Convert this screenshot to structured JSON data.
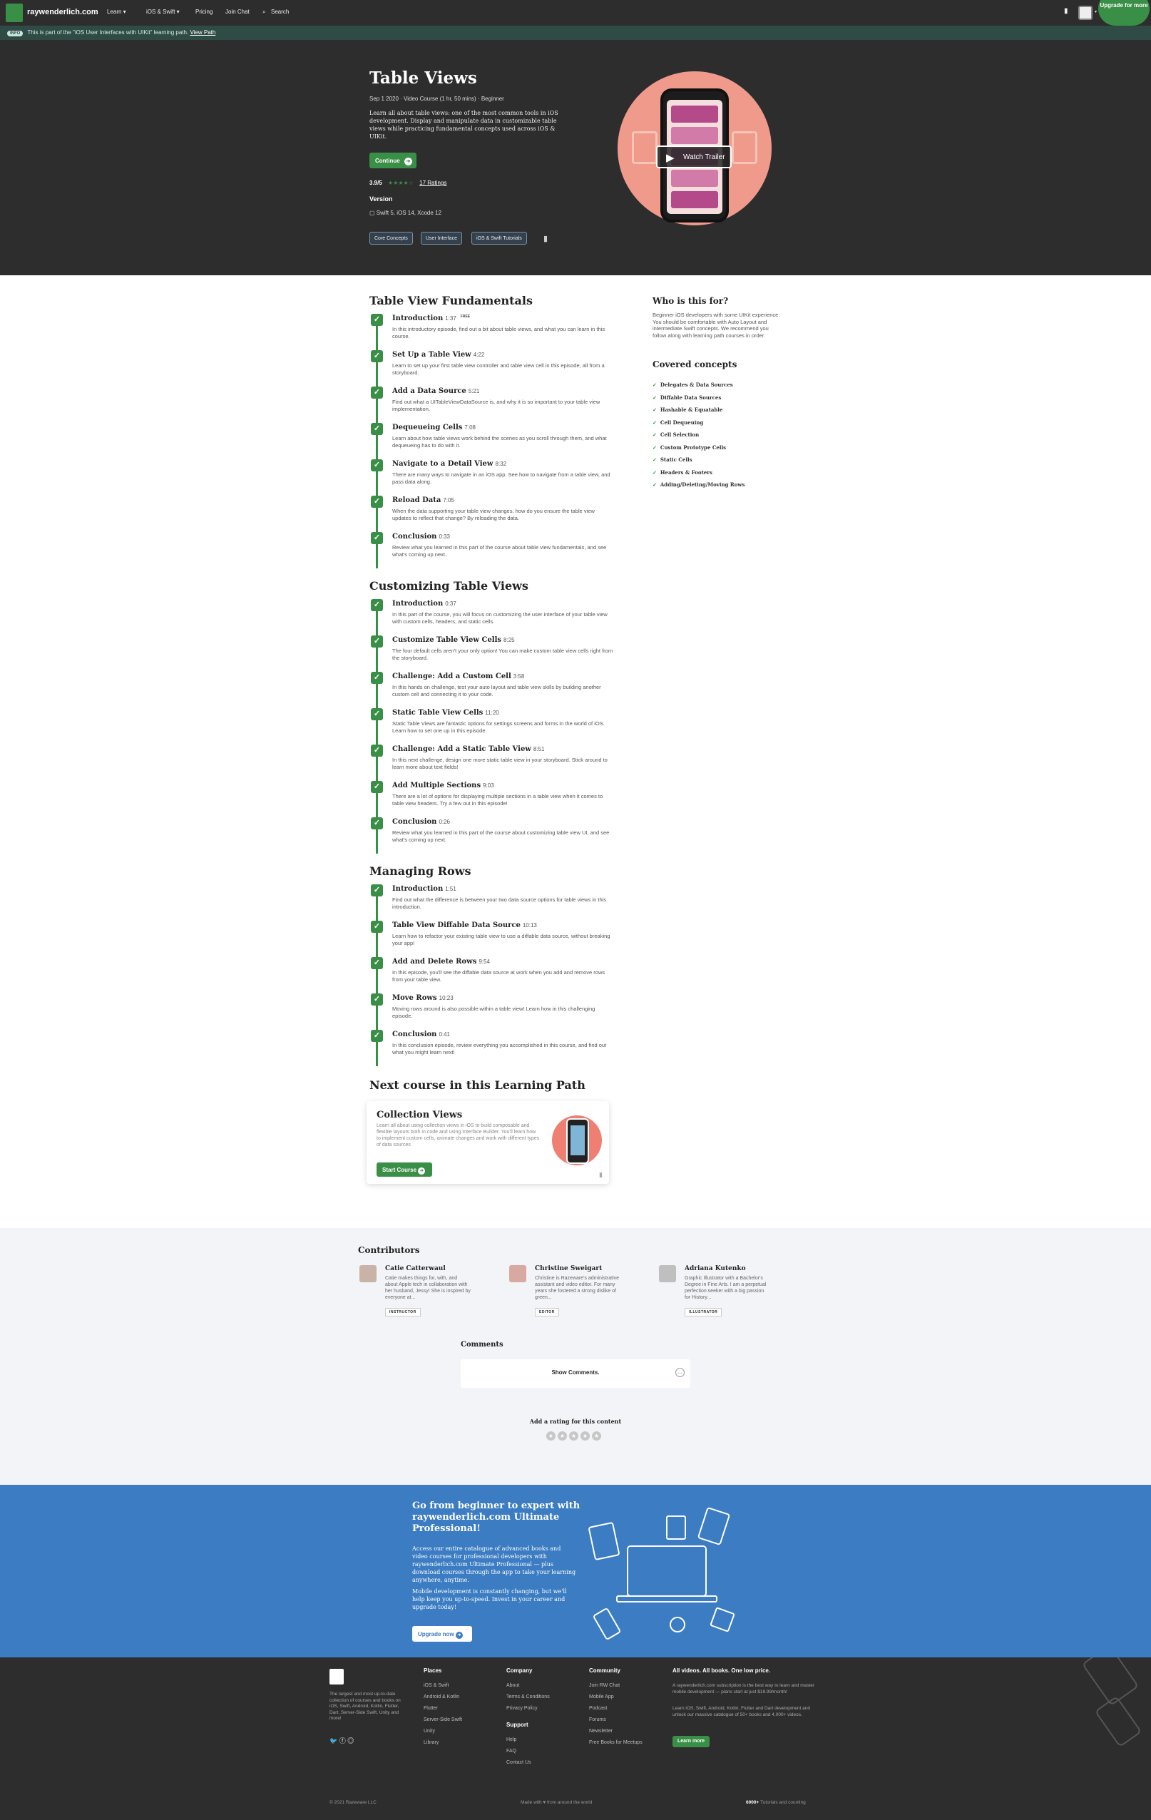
{
  "nav": {
    "brand": "raywenderlich.com",
    "items": [
      "Learn ▾",
      "iOS & Swift ▾",
      "Pricing",
      "Join Chat",
      "Search"
    ],
    "upgrade": "Upgrade for more"
  },
  "banner": {
    "tag": "INFO",
    "text": "This is part of the \"iOS User Interfaces with UIKit\" learning path.",
    "link": "View Path"
  },
  "hero": {
    "title": "Table Views",
    "meta": "Sep 1 2020 · Video Course (1 hr, 50 mins) · Beginner",
    "description": "Learn all about table views: one of the most common tools in iOS development. Display and manipulate data in customizable table views while practicing fundamental concepts used across iOS & UIKit.",
    "continue": "Continue",
    "rating": "3.9/5",
    "ratings_link": "17 Ratings",
    "version_label": "Version",
    "version": "Swift 5, iOS 14, Xcode 12",
    "chips": [
      "Core Concepts",
      "User Interface",
      "iOS & Swift Tutorials"
    ],
    "trailer": "Watch Trailer"
  },
  "sections": [
    {
      "title": "Table View Fundamentals",
      "episodes": [
        {
          "title": "Introduction",
          "dur": "1:37",
          "free": "FREE",
          "desc": "In this introductory episode, find out a bit about table views, and what you can learn in this course."
        },
        {
          "title": "Set Up a Table View",
          "dur": "4:22",
          "desc": "Learn to set up your first table view controller and table view cell in this episode, all from a storyboard."
        },
        {
          "title": "Add a Data Source",
          "dur": "5:21",
          "desc": "Find out what a UITableViewDataSource is, and why it is so important to your table view implementation."
        },
        {
          "title": "Dequeueing Cells",
          "dur": "7:08",
          "desc": "Learn about how table views work behind the scenes as you scroll through them, and what dequeueing has to do with it."
        },
        {
          "title": "Navigate to a Detail View",
          "dur": "8:32",
          "desc": "There are many ways to navigate in an iOS app. See how to navigate from a table view, and pass data along."
        },
        {
          "title": "Reload Data",
          "dur": "7:05",
          "desc": "When the data supporting your table view changes, how do you ensure the table view updates to reflect that change? By reloading the data."
        },
        {
          "title": "Conclusion",
          "dur": "0:33",
          "desc": "Review what you learned in this part of the course about table view fundamentals, and see what's coming up next."
        }
      ]
    },
    {
      "title": "Customizing Table Views",
      "episodes": [
        {
          "title": "Introduction",
          "dur": "0:37",
          "desc": "In this part of the course, you will focus on customizing the user interface of your table view with custom cells, headers, and static cells."
        },
        {
          "title": "Customize Table View Cells",
          "dur": "8:25",
          "desc": "The four default cells aren't your only option! You can make custom table view cells right from the storyboard."
        },
        {
          "title": "Challenge: Add a Custom Cell",
          "dur": "3:58",
          "desc": "In this hands on challenge, test your auto layout and table view skills by building another custom cell and connecting it to your code."
        },
        {
          "title": "Static Table View Cells",
          "dur": "11:20",
          "desc": "Static Table Views are fantastic options for settings screens and forms in the world of iOS. Learn how to set one up in this episode."
        },
        {
          "title": "Challenge: Add a Static Table View",
          "dur": "8:51",
          "desc": "In this next challenge, design one more static table view in your storyboard. Stick around to learn more about text fields!"
        },
        {
          "title": "Add Multiple Sections",
          "dur": "9:03",
          "desc": "There are a lot of options for displaying multiple sections in a table view when it comes to table view headers. Try a few out in this episode!"
        },
        {
          "title": "Conclusion",
          "dur": "0:26",
          "desc": "Review what you learned in this part of the course about customizing table view UI, and see what's coming up next."
        }
      ]
    },
    {
      "title": "Managing Rows",
      "episodes": [
        {
          "title": "Introduction",
          "dur": "1:51",
          "desc": "Find out what the difference is between your two data source options for table views in this introduction."
        },
        {
          "title": "Table View Diffable Data Source",
          "dur": "10:13",
          "desc": "Learn how to refactor your existing table view to use a diffable data source, without breaking your app!"
        },
        {
          "title": "Add and Delete Rows",
          "dur": "9:54",
          "desc": "In this episode, you'll see the diffable data source at work when you add and remove rows from your table view."
        },
        {
          "title": "Move Rows",
          "dur": "10:23",
          "desc": "Moving rows around is also possible within a table view! Learn how in this challenging episode."
        },
        {
          "title": "Conclusion",
          "dur": "0:41",
          "desc": "In this conclusion episode, review everything you accomplished in this course, and find out what you might learn next!"
        }
      ]
    }
  ],
  "side": {
    "who_title": "Who is this for?",
    "who_text": "Beginner iOS developers with some UIKit experience. You should be comfortable with Auto Layout and intermediate Swift concepts. We recommend you follow along with learning path courses in order.",
    "covered_title": "Covered concepts",
    "concepts": [
      "Delegates & Data Sources",
      "Diffable Data Sources",
      "Hashable & Equatable",
      "Cell Dequeuing",
      "Cell Selection",
      "Custom Prototype Cells",
      "Static Cells",
      "Headers & Footers",
      "Adding/Deleting/Moving Rows"
    ]
  },
  "next": {
    "heading": "Next course in this Learning Path",
    "title": "Collection Views",
    "desc": "Learn all about using collection views in iOS to build composable and flexible layouts both in code and using Interface Builder. You'll learn how to implement custom cells, animate changes and work with different types of data sources",
    "button": "Start Course"
  },
  "contributors": {
    "heading": "Contributors",
    "people": [
      {
        "name": "Catie Catterwaul",
        "desc": "Catie makes things for, with, and about Apple tech in collaboration with her husband, Jessy! She is inspired by everyone at...",
        "role": "INSTRUCTOR"
      },
      {
        "name": "Christine Sweigart",
        "desc": "Christine is Razeware's administrative assistant and video editor. For many years she fostered a strong dislike of green...",
        "role": "EDITOR"
      },
      {
        "name": "Adriana Kutenko",
        "desc": "Graphic Illustrator with a Bachelor's Degree in Fine Arts. I am a perpetual perfection seeker with a big passion for History...",
        "role": "ILLUSTRATOR"
      }
    ]
  },
  "comments": {
    "heading": "Comments",
    "show": "Show Comments.",
    "rating_label": "Add a rating for this content"
  },
  "promo": {
    "title": "Go from beginner to expert with raywenderlich.com Ultimate Professional!",
    "p1": "Access our entire catalogue of advanced books and video courses for professional developers with raywenderlich.com Ultimate Professional — plus download courses through the app to take your learning anywhere, anytime.",
    "p2": "Mobile development is constantly changing, but we'll help keep you up-to-speed. Invest in your career and upgrade today!",
    "button": "Upgrade now"
  },
  "footer": {
    "about": "The largest and most up-to-date collection of courses and books on iOS, Swift, Android, Kotlin, Flutter, Dart, Server-Side Swift, Unity and more!",
    "places_title": "Places",
    "places": [
      "iOS & Swift",
      "Android & Kotlin",
      "Flutter",
      "Server-Side Swift",
      "Unity",
      "Library"
    ],
    "company_title": "Company",
    "company": [
      "About",
      "Terms & Conditions",
      "Privacy Policy"
    ],
    "support_title": "Support",
    "support": [
      "Help",
      "FAQ",
      "Contact Us"
    ],
    "community_title": "Community",
    "community": [
      "Join RW Chat",
      "Mobile App",
      "Podcast",
      "Forums",
      "Newsletter",
      "Free Books for Meetups"
    ],
    "all_title": "All videos. All books. One low price.",
    "all_p1": "A raywenderlich.com subscription is the best way to learn and master mobile development — plans start at just $19.99/month!",
    "all_p2": "Learn iOS, Swift, Android, Kotlin, Flutter and Dart development and unlock our massive catalogue of 50+ books and 4,000+ videos.",
    "learn_more": "Learn more",
    "copyright": "© 2021 Razeware LLC",
    "made": "Made with ♥ from around the world",
    "count": "6000+",
    "count_label": "Tutorials and counting"
  }
}
